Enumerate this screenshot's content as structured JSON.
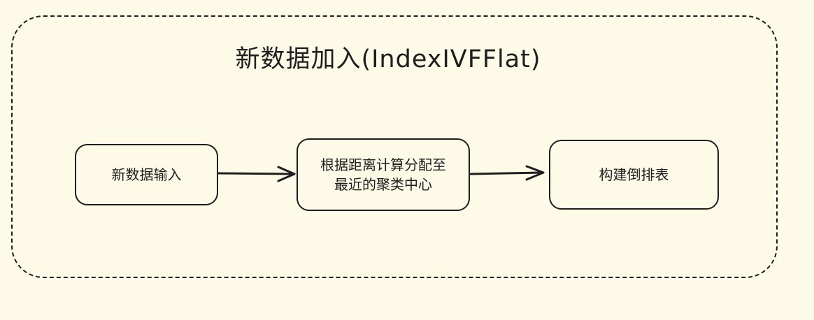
{
  "title": "新数据加入(IndexIVFFlat)",
  "nodes": {
    "input": "新数据输入",
    "assign": "根据距离计算分配至\n最近的聚类中心",
    "build": "构建倒排表"
  },
  "edges": [
    {
      "from": "新数据输入",
      "to": "根据距离计算分配至最近的聚类中心"
    },
    {
      "from": "根据距离计算分配至最近的聚类中心",
      "to": "构建倒排表"
    }
  ],
  "colors": {
    "background": "#fdfae8",
    "stroke": "#1e1e1e"
  }
}
